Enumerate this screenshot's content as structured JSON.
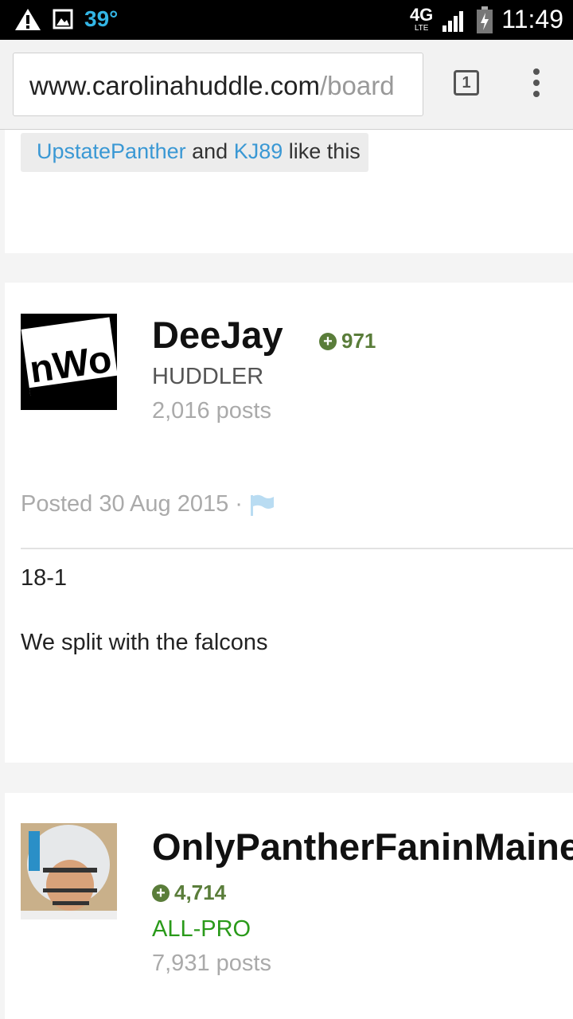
{
  "status_bar": {
    "temperature": "39°",
    "network": "4G",
    "network_sub": "LTE",
    "time": "11:49",
    "icons": [
      "warning-icon",
      "image-icon",
      "signal-icon",
      "battery-icon"
    ]
  },
  "browser": {
    "url_domain": "www.carolinahuddle.com",
    "url_path": "/board",
    "tab_count": "1",
    "icons": [
      "tabs-icon",
      "overflow-menu-icon"
    ]
  },
  "likes": {
    "user1": "UpstatePanther",
    "joiner": "and",
    "user2": "KJ89",
    "suffix": "like this"
  },
  "posts": [
    {
      "username": "DeeJay",
      "reputation": "971",
      "rank": "HUDDLER",
      "post_count": "2,016 posts",
      "posted": "Posted 30 Aug 2015 ·",
      "body": [
        "18-1",
        "We split with the falcons"
      ]
    },
    {
      "username": "OnlyPantherFaninMaine",
      "reputation": "4,714",
      "rank": "ALL-PRO",
      "post_count": "7,931 posts"
    }
  ],
  "colors": {
    "link": "#3a98d4",
    "reputation": "#5a7d3a",
    "rank_allpro": "#2a9a1a",
    "status_temp": "#33b5e5"
  }
}
